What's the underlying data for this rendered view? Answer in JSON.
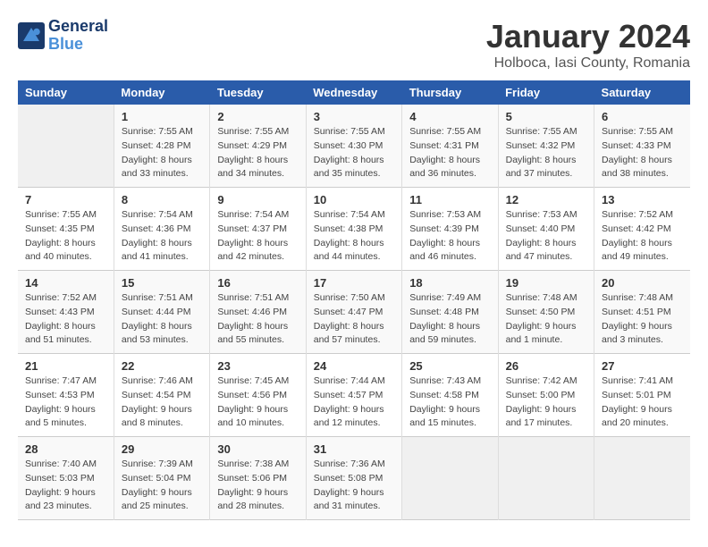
{
  "header": {
    "logo_line1": "General",
    "logo_line2": "Blue",
    "title": "January 2024",
    "subtitle": "Holboca, Iasi County, Romania"
  },
  "columns": [
    "Sunday",
    "Monday",
    "Tuesday",
    "Wednesday",
    "Thursday",
    "Friday",
    "Saturday"
  ],
  "weeks": [
    [
      {
        "day": "",
        "info": ""
      },
      {
        "day": "1",
        "info": "Sunrise: 7:55 AM\nSunset: 4:28 PM\nDaylight: 8 hours\nand 33 minutes."
      },
      {
        "day": "2",
        "info": "Sunrise: 7:55 AM\nSunset: 4:29 PM\nDaylight: 8 hours\nand 34 minutes."
      },
      {
        "day": "3",
        "info": "Sunrise: 7:55 AM\nSunset: 4:30 PM\nDaylight: 8 hours\nand 35 minutes."
      },
      {
        "day": "4",
        "info": "Sunrise: 7:55 AM\nSunset: 4:31 PM\nDaylight: 8 hours\nand 36 minutes."
      },
      {
        "day": "5",
        "info": "Sunrise: 7:55 AM\nSunset: 4:32 PM\nDaylight: 8 hours\nand 37 minutes."
      },
      {
        "day": "6",
        "info": "Sunrise: 7:55 AM\nSunset: 4:33 PM\nDaylight: 8 hours\nand 38 minutes."
      }
    ],
    [
      {
        "day": "7",
        "info": "Sunrise: 7:55 AM\nSunset: 4:35 PM\nDaylight: 8 hours\nand 40 minutes."
      },
      {
        "day": "8",
        "info": "Sunrise: 7:54 AM\nSunset: 4:36 PM\nDaylight: 8 hours\nand 41 minutes."
      },
      {
        "day": "9",
        "info": "Sunrise: 7:54 AM\nSunset: 4:37 PM\nDaylight: 8 hours\nand 42 minutes."
      },
      {
        "day": "10",
        "info": "Sunrise: 7:54 AM\nSunset: 4:38 PM\nDaylight: 8 hours\nand 44 minutes."
      },
      {
        "day": "11",
        "info": "Sunrise: 7:53 AM\nSunset: 4:39 PM\nDaylight: 8 hours\nand 46 minutes."
      },
      {
        "day": "12",
        "info": "Sunrise: 7:53 AM\nSunset: 4:40 PM\nDaylight: 8 hours\nand 47 minutes."
      },
      {
        "day": "13",
        "info": "Sunrise: 7:52 AM\nSunset: 4:42 PM\nDaylight: 8 hours\nand 49 minutes."
      }
    ],
    [
      {
        "day": "14",
        "info": "Sunrise: 7:52 AM\nSunset: 4:43 PM\nDaylight: 8 hours\nand 51 minutes."
      },
      {
        "day": "15",
        "info": "Sunrise: 7:51 AM\nSunset: 4:44 PM\nDaylight: 8 hours\nand 53 minutes."
      },
      {
        "day": "16",
        "info": "Sunrise: 7:51 AM\nSunset: 4:46 PM\nDaylight: 8 hours\nand 55 minutes."
      },
      {
        "day": "17",
        "info": "Sunrise: 7:50 AM\nSunset: 4:47 PM\nDaylight: 8 hours\nand 57 minutes."
      },
      {
        "day": "18",
        "info": "Sunrise: 7:49 AM\nSunset: 4:48 PM\nDaylight: 8 hours\nand 59 minutes."
      },
      {
        "day": "19",
        "info": "Sunrise: 7:48 AM\nSunset: 4:50 PM\nDaylight: 9 hours\nand 1 minute."
      },
      {
        "day": "20",
        "info": "Sunrise: 7:48 AM\nSunset: 4:51 PM\nDaylight: 9 hours\nand 3 minutes."
      }
    ],
    [
      {
        "day": "21",
        "info": "Sunrise: 7:47 AM\nSunset: 4:53 PM\nDaylight: 9 hours\nand 5 minutes."
      },
      {
        "day": "22",
        "info": "Sunrise: 7:46 AM\nSunset: 4:54 PM\nDaylight: 9 hours\nand 8 minutes."
      },
      {
        "day": "23",
        "info": "Sunrise: 7:45 AM\nSunset: 4:56 PM\nDaylight: 9 hours\nand 10 minutes."
      },
      {
        "day": "24",
        "info": "Sunrise: 7:44 AM\nSunset: 4:57 PM\nDaylight: 9 hours\nand 12 minutes."
      },
      {
        "day": "25",
        "info": "Sunrise: 7:43 AM\nSunset: 4:58 PM\nDaylight: 9 hours\nand 15 minutes."
      },
      {
        "day": "26",
        "info": "Sunrise: 7:42 AM\nSunset: 5:00 PM\nDaylight: 9 hours\nand 17 minutes."
      },
      {
        "day": "27",
        "info": "Sunrise: 7:41 AM\nSunset: 5:01 PM\nDaylight: 9 hours\nand 20 minutes."
      }
    ],
    [
      {
        "day": "28",
        "info": "Sunrise: 7:40 AM\nSunset: 5:03 PM\nDaylight: 9 hours\nand 23 minutes."
      },
      {
        "day": "29",
        "info": "Sunrise: 7:39 AM\nSunset: 5:04 PM\nDaylight: 9 hours\nand 25 minutes."
      },
      {
        "day": "30",
        "info": "Sunrise: 7:38 AM\nSunset: 5:06 PM\nDaylight: 9 hours\nand 28 minutes."
      },
      {
        "day": "31",
        "info": "Sunrise: 7:36 AM\nSunset: 5:08 PM\nDaylight: 9 hours\nand 31 minutes."
      },
      {
        "day": "",
        "info": ""
      },
      {
        "day": "",
        "info": ""
      },
      {
        "day": "",
        "info": ""
      }
    ]
  ]
}
